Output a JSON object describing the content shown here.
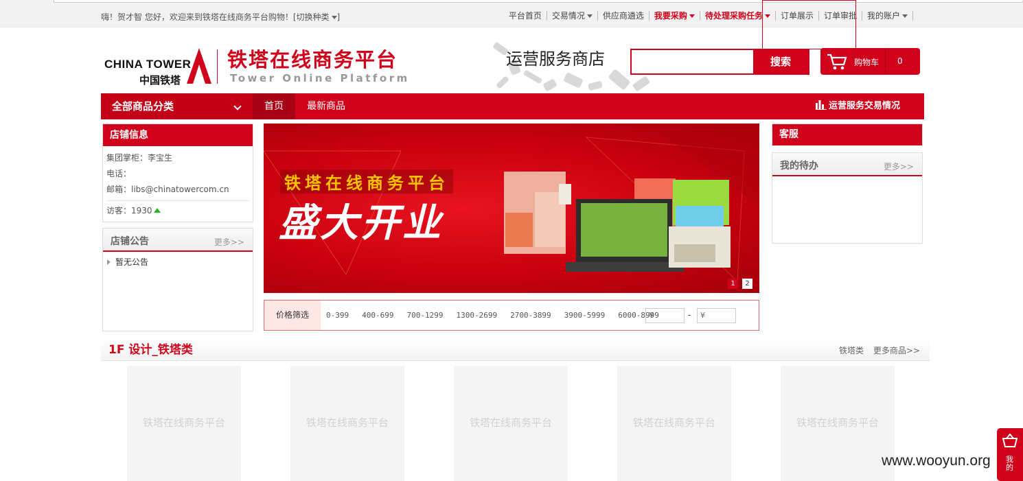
{
  "topbar": {
    "greeting": "嗨！贺才智 您好，欢迎来到铁塔在线商务平台购物！[切换种类",
    "nav": [
      {
        "label": "平台首页",
        "caret": false,
        "red": false
      },
      {
        "label": "交易情况",
        "caret": true,
        "red": false
      },
      {
        "label": "供应商遴选",
        "caret": false,
        "red": false
      },
      {
        "label": "我要采购",
        "caret": true,
        "red": true
      },
      {
        "label": "待处理采购任务",
        "caret": true,
        "red": true
      },
      {
        "label": "订单展示",
        "caret": false,
        "red": false
      },
      {
        "label": "订单审批",
        "caret": false,
        "red": false
      },
      {
        "label": "我的账户",
        "caret": true,
        "red": false
      }
    ]
  },
  "header": {
    "logo_en": "CHINA TOWER",
    "logo_cn": "中国铁塔",
    "platform_title": "铁塔在线商务平台",
    "platform_sub": "Tower Online Platform",
    "store_name": "运营服务商店",
    "search_button": "搜索",
    "cart_label": "购物车",
    "cart_count": "0"
  },
  "navbar": {
    "all_categories": "全部商品分类",
    "home": "首页",
    "new_products": "最新商品",
    "stats_link": "运营服务交易情况"
  },
  "shop_info": {
    "title": "店铺信息",
    "manager": "集团掌柜：李宝生",
    "phone": "电话：",
    "email": "邮箱：libs@chinatowercom.cn",
    "visits": "访客：1930"
  },
  "notice": {
    "title": "店铺公告",
    "more": "更多>>",
    "item": "暂无公告"
  },
  "banner": {
    "title": "铁塔在线商务平台",
    "headline": "盛大开业",
    "dots": [
      "1",
      "2"
    ]
  },
  "price_filter": {
    "label": "价格筛选",
    "ranges": [
      "0-399",
      "400-699",
      "700-1299",
      "1300-2699",
      "2700-3899",
      "3900-5999",
      "6000-8999"
    ],
    "min_placeholder": "¥",
    "max_placeholder": "¥",
    "dash": "-"
  },
  "service": {
    "title": "客服",
    "todo_title": "我的待办",
    "todo_more": "更多>>"
  },
  "floor": {
    "title": "1F 设计_铁塔类",
    "category_link": "铁塔类",
    "more_link": "更多商品>>"
  },
  "products": [
    {
      "placeholder": "铁塔在线商务平台"
    },
    {
      "placeholder": "铁塔在线商务平台"
    },
    {
      "placeholder": "铁塔在线商务平台"
    },
    {
      "placeholder": "铁塔在线商务平台"
    },
    {
      "placeholder": "铁塔在线商务平台"
    }
  ],
  "watermark": "www.wooyun.org",
  "side_basket": "我的"
}
